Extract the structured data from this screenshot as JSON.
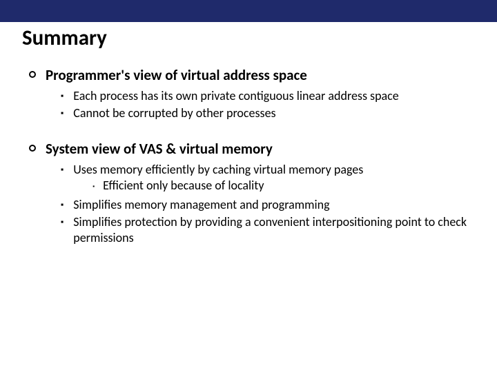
{
  "title": "Summary",
  "sections": [
    {
      "heading": "Programmer's view of virtual address space",
      "items": [
        {
          "text": "Each process has its own private contiguous linear address space"
        },
        {
          "text": "Cannot be corrupted by other processes"
        }
      ]
    },
    {
      "heading": "System view of VAS & virtual memory",
      "items": [
        {
          "text": "Uses memory efficiently by caching virtual memory pages",
          "subitems": [
            {
              "text": "Efficient only because of locality"
            }
          ]
        },
        {
          "text": "Simplifies memory management and programming"
        },
        {
          "text": "Simplifies protection by providing a convenient interpositioning point to check permissions"
        }
      ]
    }
  ]
}
